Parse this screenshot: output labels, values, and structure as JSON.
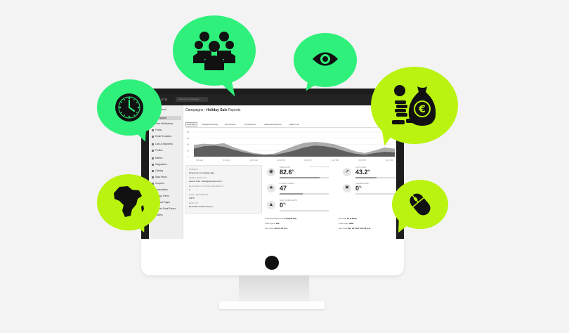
{
  "app": {
    "logo": "ACTO",
    "search_placeholder": "Search for campaigns..."
  },
  "breadcrumb": {
    "section": "Campaigns",
    "separator": "›",
    "current": "Holiday Sale",
    "suffix": "Reports"
  },
  "sidebar": {
    "items": [
      {
        "label": "Dashboard"
      },
      {
        "label": "Campaigns",
        "active": true
      },
      {
        "label": "Push Notifications"
      },
      {
        "label": "Forms"
      },
      {
        "label": "Email Templates"
      },
      {
        "label": "Lists & Segments"
      },
      {
        "label": "Profiles"
      },
      {
        "label": "Metrics"
      },
      {
        "label": "Integrations"
      },
      {
        "label": "Catalog"
      },
      {
        "label": "Data Feeds"
      },
      {
        "label": "Coupons"
      },
      {
        "label": "Automations"
      },
      {
        "label": "Signup Forms"
      },
      {
        "label": "Product Pages"
      },
      {
        "label": "Embed Email Forms"
      },
      {
        "label": "Folders"
      }
    ]
  },
  "tabs": [
    {
      "label": "Overview",
      "active": true
    },
    {
      "label": "Recipient Activity"
    },
    {
      "label": "Link Activity"
    },
    {
      "label": "Conversions"
    },
    {
      "label": "Advanced Reports"
    },
    {
      "label": "Watch List"
    }
  ],
  "chart_data": {
    "type": "area",
    "title": "",
    "xlabel": "",
    "ylabel": "",
    "y_ticks": [
      "80",
      "60",
      "40",
      "20",
      "0"
    ],
    "x_ticks": [
      "6:00 AM",
      "8:00 AM",
      "10:00 AM",
      "12:00 PM",
      "2:00 PM",
      "4:00 PM",
      "6:00 PM",
      "8:00 PM"
    ],
    "ylim": [
      0,
      80
    ],
    "grid": true,
    "series": [
      {
        "values": [
          38,
          42,
          40,
          44,
          30,
          20,
          12,
          8,
          10,
          22,
          35,
          45,
          48,
          46,
          40,
          30,
          18,
          12,
          20,
          30,
          26
        ],
        "color": "#9c9c9c"
      },
      {
        "values": [
          26,
          34,
          36,
          32,
          22,
          14,
          8,
          5,
          6,
          12,
          20,
          30,
          36,
          34,
          28,
          18,
          10,
          6,
          12,
          16,
          14
        ],
        "color": "#555555"
      }
    ]
  },
  "details": {
    "subject_label": "SUBJECT",
    "subject": "Check out our Holiday sale",
    "from_label": "FROM / REPLY-TO",
    "from": "Lauren Pike <hello@actotepa.com>",
    "excluded_label": "EXCLUDED LISTS AND SEGMENTS",
    "excluded": "2",
    "total_label": "TOTAL RECIPIENTS",
    "total": "9,875",
    "sent_label": "SENT ON",
    "sent": "December 15 at 1:15 p.m."
  },
  "metrics": [
    {
      "label": "OPEN RATE",
      "value": "82.6",
      "unit": "%",
      "icon": "eye-icon",
      "glyph": "◉",
      "fill": 0.82,
      "note": "Opens that are only counted"
    },
    {
      "label": "CLICK RATE",
      "value": "43.2",
      "unit": "%",
      "icon": "external-link-icon",
      "glyph": "⇗",
      "fill": 0.43,
      "note": ""
    },
    {
      "label": "PLACED ORDER",
      "value": "47",
      "unit": "",
      "icon": "star-icon",
      "glyph": "★",
      "fill": 0.47,
      "note": ""
    },
    {
      "label": "UNSUBSCRIBE",
      "value": "0",
      "unit": "%",
      "icon": "x-icon",
      "glyph": "✖",
      "fill": 0.0,
      "note": ""
    },
    {
      "label": "SPAM COMPLAINTS",
      "value": "0",
      "unit": "%",
      "icon": "warning-icon",
      "glyph": "▲",
      "fill": 0.0,
      "note": ""
    }
  ],
  "stats_left": [
    {
      "label": "Successful Deliveries",
      "value": "9,739 (98.6%)"
    },
    {
      "label": "Total Opens",
      "value": "526"
    },
    {
      "label": "Last Open",
      "value": "Sent 9:12 a.m."
    }
  ],
  "stats_right": [
    {
      "label": "Bounced",
      "value": "92 (0.63%)"
    },
    {
      "label": "Total Clicks",
      "value": "3368"
    },
    {
      "label": "Last Click",
      "value": "Dec 19, 2017 at 9:18 p.m."
    }
  ],
  "colors": {
    "bubble_primary": "#2ef07a",
    "bubble_secondary": "#b9f30f",
    "screen_frame": "#1d1d1d"
  },
  "bubbles": [
    {
      "icon": "people-icon"
    },
    {
      "icon": "eye-icon"
    },
    {
      "icon": "clock-icon"
    },
    {
      "icon": "money-bag-icon"
    },
    {
      "icon": "africa-map-icon"
    },
    {
      "icon": "mouse-icon"
    }
  ]
}
